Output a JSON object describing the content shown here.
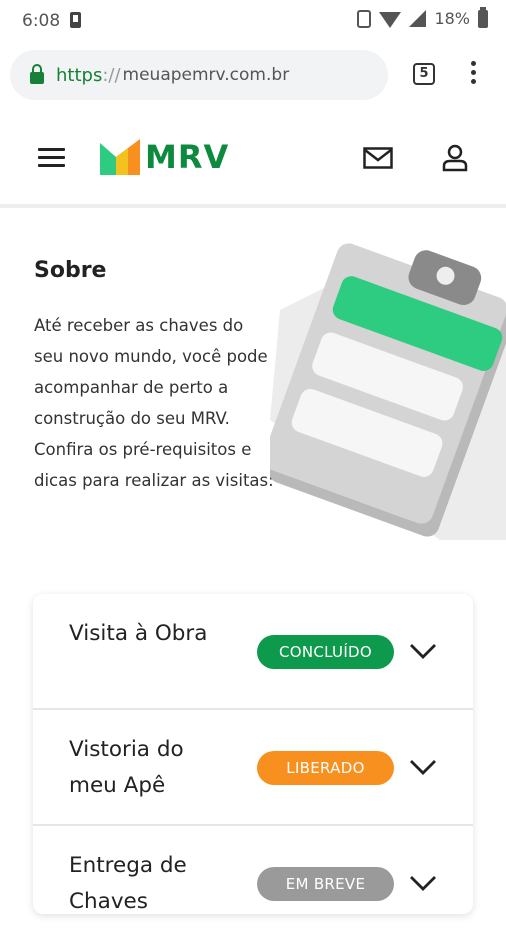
{
  "statusbar": {
    "time": "6:08",
    "battery": "18%"
  },
  "browser": {
    "url_scheme": "https",
    "url_sep": "://",
    "url_host": "meuapemrv.com.br",
    "tab_count": "5"
  },
  "header": {
    "logo_text": "MRV"
  },
  "about": {
    "title": "Sobre",
    "text": "Até receber as chaves do seu novo mundo, você pode acompanhar de perto a construção do seu MRV. Confira os pré-requisitos e dicas para realizar as visitas:"
  },
  "steps": [
    {
      "label": "Visita à Obra",
      "status": "CONCLUÍDO",
      "status_color": "#0e9a4c"
    },
    {
      "label": "Vistoria do meu Apê",
      "status": "LIBERADO",
      "status_color": "#f7901e"
    },
    {
      "label": "Entrega de Chaves",
      "status": "EM BREVE",
      "status_color": "#9a9a9a"
    }
  ],
  "colors": {
    "brand_green": "#0e8a3e",
    "accent_green": "#2ecc80",
    "orange": "#f7901e"
  },
  "icons": [
    "lock-icon",
    "tabs-icon",
    "menu-icon",
    "hamburger-icon",
    "mail-icon",
    "user-icon",
    "chevron-down-icon"
  ]
}
